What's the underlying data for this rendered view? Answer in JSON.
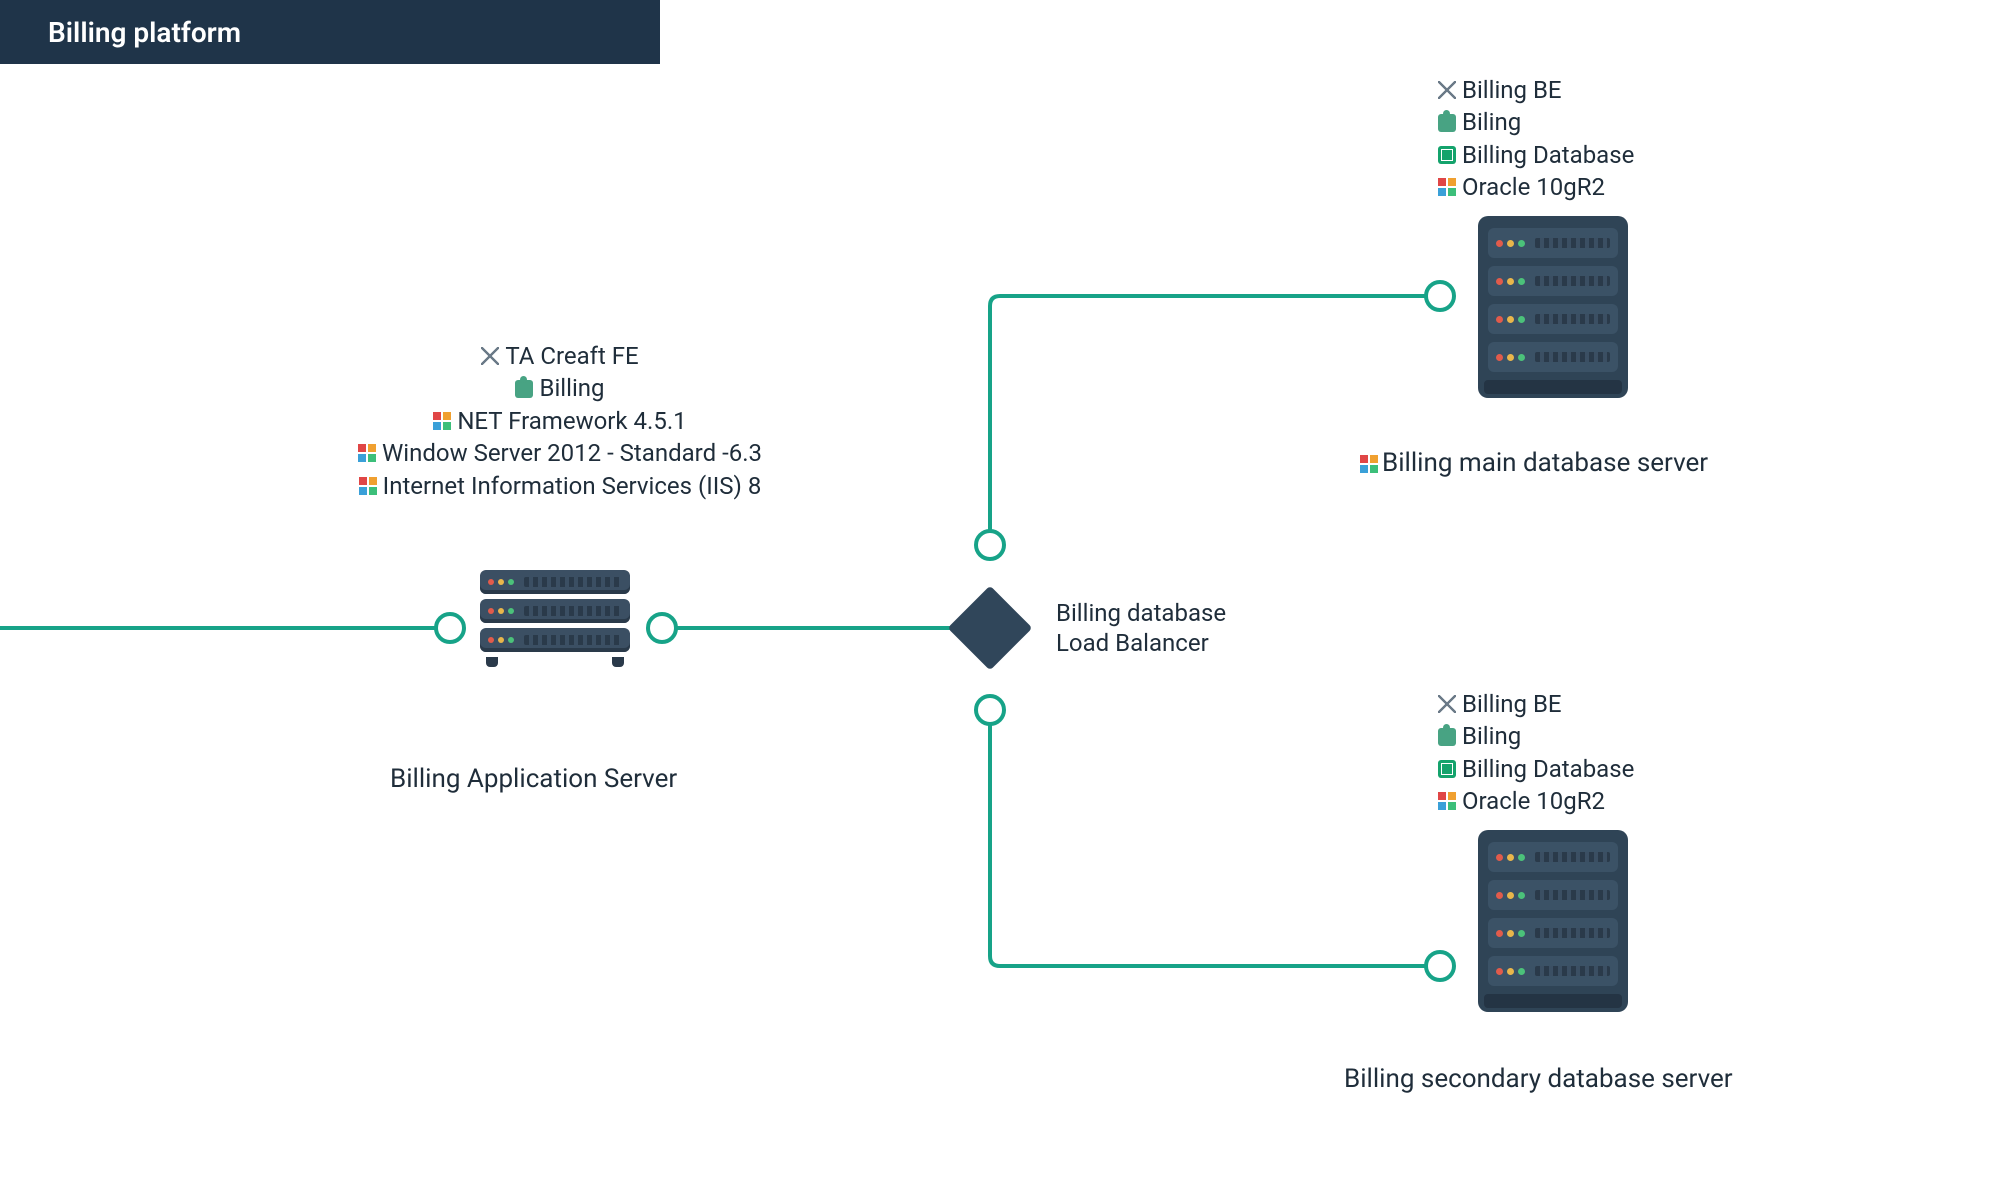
{
  "title": "Billing platform",
  "app_server": {
    "caption": "Billing Application Server",
    "specs": [
      "TA Creaft FE",
      "Billing",
      "NET Framework 4.5.1",
      "Window Server 2012 - Standard -6.3",
      "Internet Information Services (IIS) 8"
    ],
    "spec_icons": [
      "tools",
      "puzzle",
      "grid",
      "grid",
      "grid"
    ]
  },
  "load_balancer": {
    "line1": "Billing database",
    "line2": "Load Balancer"
  },
  "db_main": {
    "caption": "Billing main database server",
    "specs": [
      "Billing BE",
      "Biling",
      "Billing Database",
      "Oracle 10gR2"
    ],
    "spec_icons": [
      "tools",
      "puzzle",
      "db",
      "grid"
    ]
  },
  "db_secondary": {
    "caption": "Billing secondary database server",
    "specs": [
      "Billing BE",
      "Biling",
      "Billing Database",
      "Oracle 10gR2"
    ],
    "spec_icons": [
      "tools",
      "puzzle",
      "db",
      "grid"
    ]
  }
}
